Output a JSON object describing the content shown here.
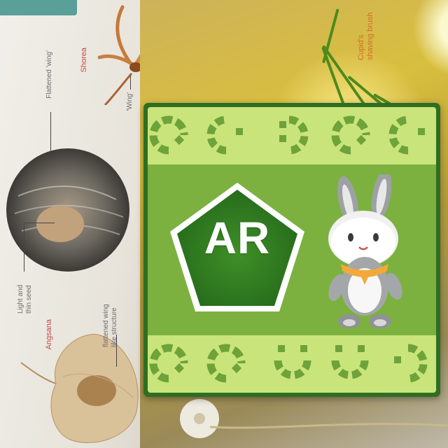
{
  "book": {
    "label_wing_shorea": "'Wing'",
    "label_flattened_wing": "Flattened 'wing'",
    "label_shorea": "Shorea",
    "label_light_seed": "Light and thin seed",
    "label_flattened_wing_like": "flattened wing like structure",
    "label_angsana": "Angsana",
    "label_cupid": "Cupid's shaving brush"
  },
  "card": {
    "badge_text": "AR",
    "colors": {
      "frame": "#2e6e22",
      "panel": "#7cb140",
      "band": "#c9e47a",
      "pattern": "#6ea33a",
      "badge": "#2d7a1e",
      "scarf": "#f2a93a"
    },
    "pattern_icons": "dotted-arc-glyphs",
    "mascot": "bunny-mascot"
  }
}
